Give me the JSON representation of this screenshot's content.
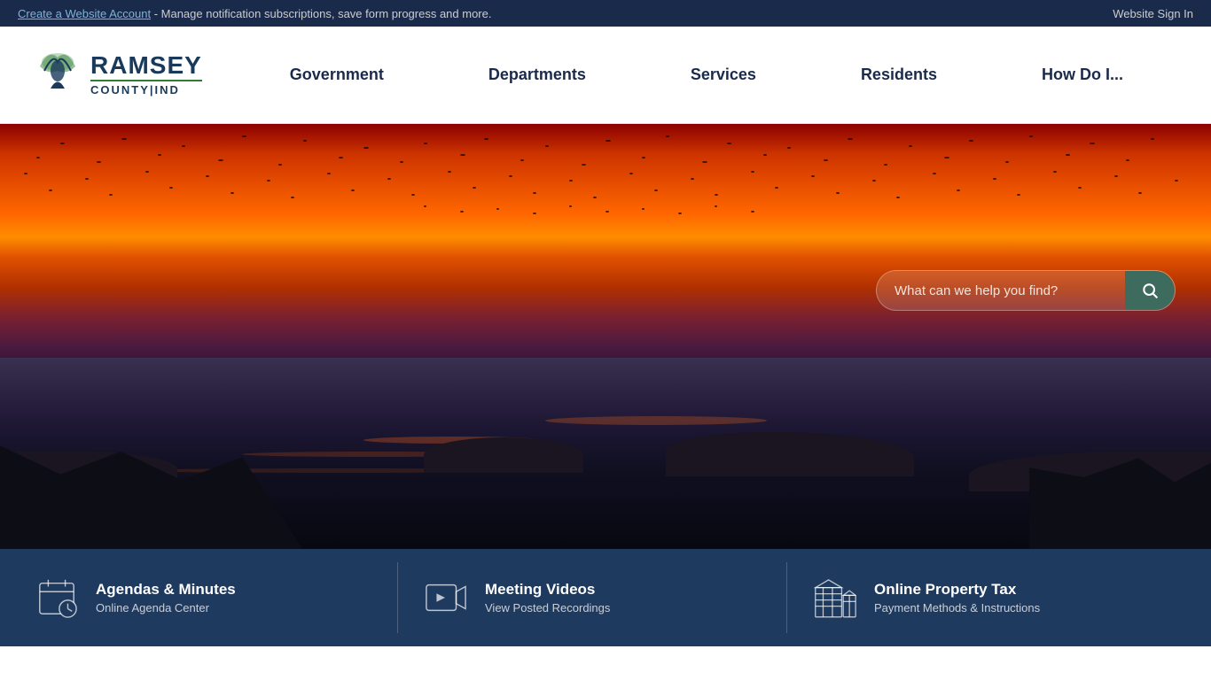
{
  "topbar": {
    "create_account_link": "Create a Website Account",
    "create_account_desc": " - Manage notification subscriptions, save form progress and more.",
    "sign_in_label": "Website Sign In"
  },
  "header": {
    "logo": {
      "ramsey": "RAMSEY",
      "county_ind": "COUNTY|IND"
    },
    "nav_items": [
      {
        "label": "Government",
        "id": "government"
      },
      {
        "label": "Departments",
        "id": "departments"
      },
      {
        "label": "Services",
        "id": "services"
      },
      {
        "label": "Residents",
        "id": "residents"
      },
      {
        "label": "How Do I...",
        "id": "how-do-i"
      }
    ]
  },
  "search": {
    "placeholder": "What can we help you find?",
    "button_label": "Search"
  },
  "quick_links": [
    {
      "id": "agendas",
      "title": "Agendas & Minutes",
      "subtitle": "Online Agenda Center",
      "icon": "calendar-icon"
    },
    {
      "id": "meeting-videos",
      "title": "Meeting Videos",
      "subtitle": "View Posted Recordings",
      "icon": "video-icon"
    },
    {
      "id": "property-tax",
      "title": "Online Property Tax",
      "subtitle": "Payment Methods & Instructions",
      "icon": "building-icon"
    }
  ]
}
